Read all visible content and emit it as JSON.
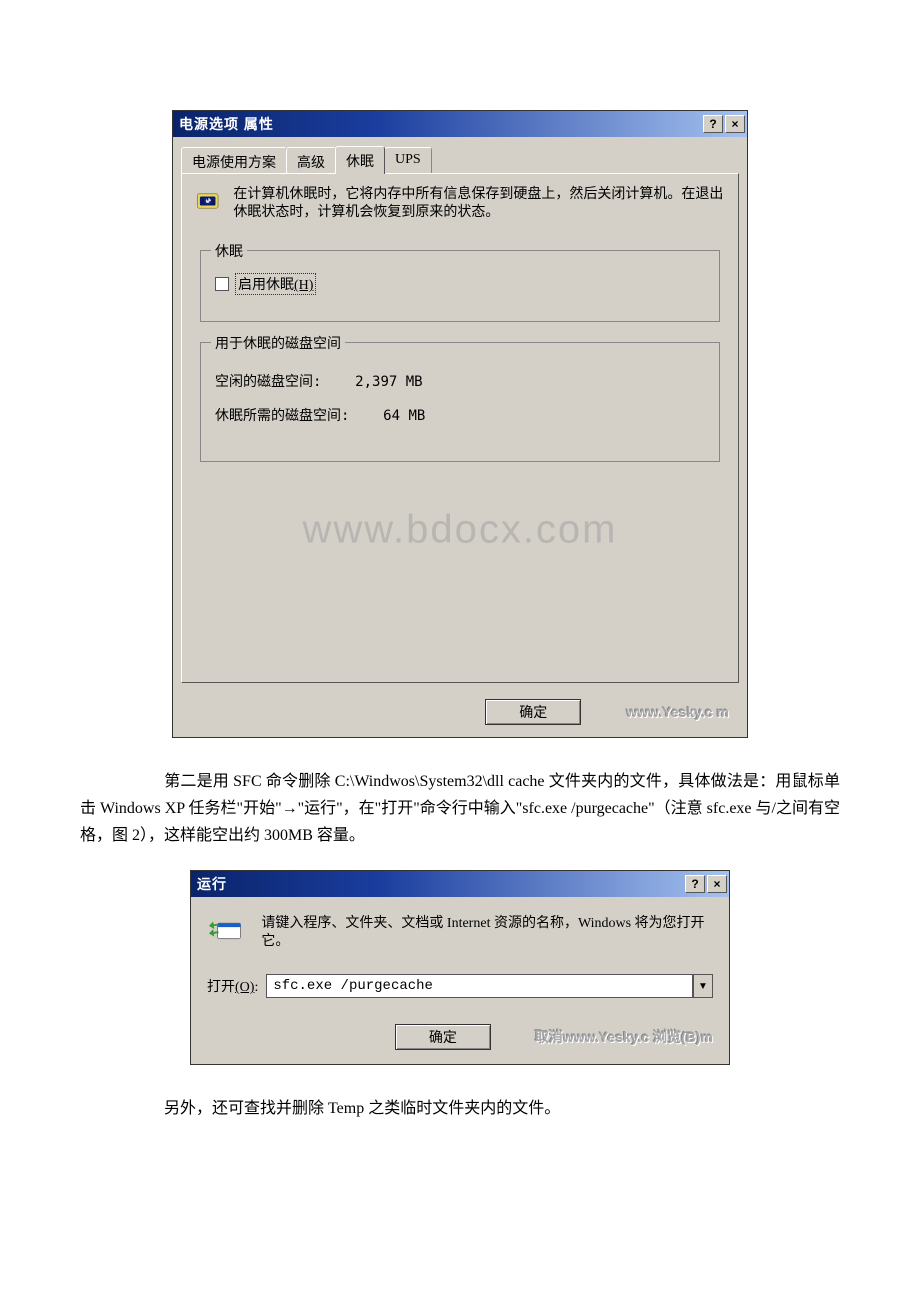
{
  "dialog1": {
    "title": "电源选项 属性",
    "help_btn": "?",
    "close_btn": "×",
    "tabs": {
      "t0": "电源使用方案",
      "t1": "高级",
      "t2": "休眠",
      "t3": "UPS"
    },
    "description": "在计算机休眠时，它将内存中所有信息保存到硬盘上，然后关闭计算机。在退出休眠状态时，计算机会恢复到原来的状态。",
    "group_hibernate_title": "休眠",
    "enable_hibernate_label": "启用休眠",
    "enable_hibernate_hotkey": "(H)",
    "group_disk_title": "用于休眠的磁盘空间",
    "disk_free_label": "空闲的磁盘空间:",
    "disk_free_value": "2,397 MB",
    "disk_need_label": "休眠所需的磁盘空间:",
    "disk_need_value": "64 MB",
    "ok_label": "确定",
    "watermark_btn_text": "www.Yesky.c    m",
    "page_watermark": "www.bdocx.com"
  },
  "para1": "第二是用 SFC 命令删除 C:\\Windwos\\System32\\dll cache 文件夹内的文件，具体做法是：用鼠标单击 Windows XP 任务栏\"开始\"→\"运行\"，在\"打开\"命令行中输入\"sfc.exe /purgecache\"（注意 sfc.exe 与/之间有空格，图 2），这样能空出约 300MB 容量。",
  "dialog2": {
    "title": "运行",
    "help_btn": "?",
    "close_btn": "×",
    "description": "请键入程序、文件夹、文档或 Internet 资源的名称，Windows 将为您打开它。",
    "open_label": "打开",
    "open_hotkey": "(O)",
    "colon": ":",
    "command_value": "sfc.exe /purgecache",
    "ok_label": "确定",
    "watermark_btn_text": "取消www.Yesky.c    浏览(B)m"
  },
  "para2": "另外，还可查找并删除 Temp 之类临时文件夹内的文件。"
}
